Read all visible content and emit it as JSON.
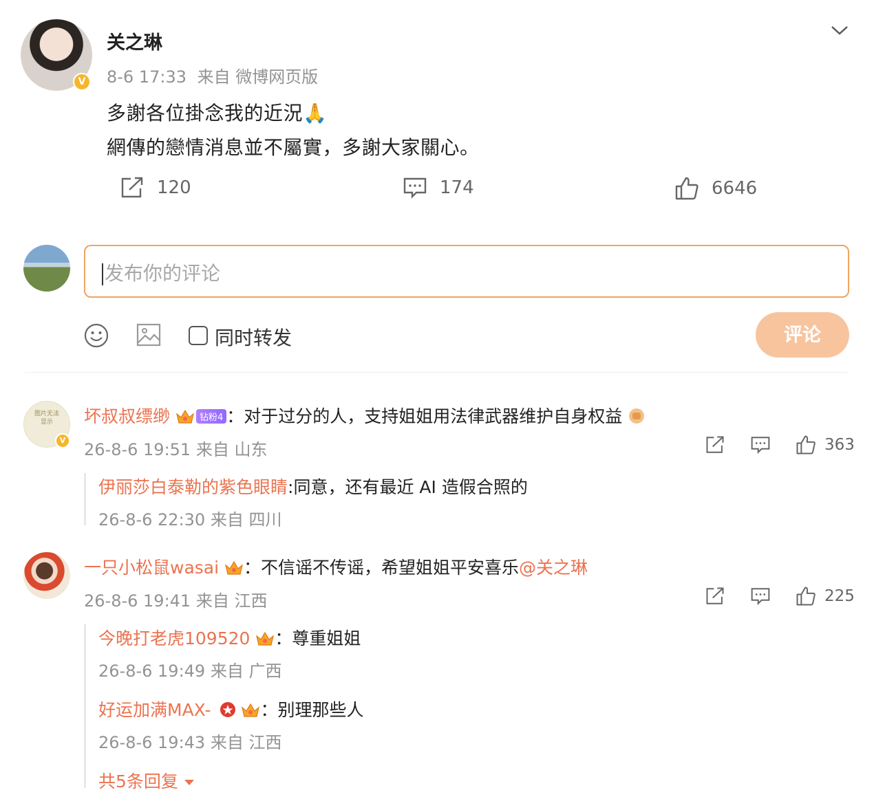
{
  "post": {
    "author": "关之琳",
    "time": "8-6 17:33",
    "source": "来自 微博网页版",
    "line1": "多謝各位掛念我的近況🙏",
    "line2": "網傳的戀情消息並不屬實，多謝大家關心。",
    "reposts": "120",
    "comments": "174",
    "likes": "6646"
  },
  "composer": {
    "placeholder": "发布你的评论",
    "repost_label": "同时转发",
    "submit_label": "评论"
  },
  "comments": [
    {
      "name": "坏叔叔缥缈",
      "fan_badge": "钻粉4",
      "colon": "：",
      "text": "对于过分的人，支持姐姐用法律武器维护自身权益",
      "time": "26-8-6 19:51 来自 山东",
      "likes": "363",
      "avatar_text": "图片无法显示",
      "replies": [
        {
          "name": "伊丽莎白泰勒的紫色眼睛",
          "colon": ":",
          "text": "同意，还有最近 AI 造假合照的",
          "time": "26-8-6 22:30 来自 四川"
        }
      ]
    },
    {
      "name": "一只小松鼠wasai",
      "colon": "：",
      "text": "不信谣不传谣，希望姐姐平安喜乐",
      "mention": "@关之琳",
      "time": "26-8-6 19:41 来自 江西",
      "likes": "225",
      "replies": [
        {
          "name": "今晚打老虎109520",
          "colon": "：",
          "text": "尊重姐姐",
          "time": "26-8-6 19:49 来自 广西"
        },
        {
          "name": "好运加满MAX-",
          "colon": "：",
          "text": "别理那些人",
          "time": "26-8-6 19:43 来自 江西"
        }
      ],
      "more_replies": "共5条回复"
    }
  ],
  "colors": {
    "accent": "#eb7350",
    "submit_bg": "#f7c49e",
    "composer_border": "#f0a35e",
    "verified": "#f6b62b"
  }
}
